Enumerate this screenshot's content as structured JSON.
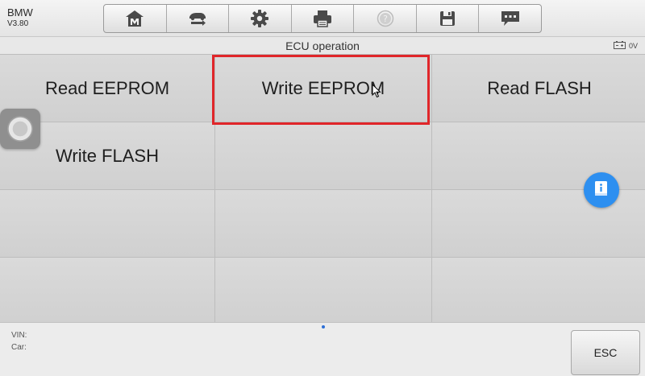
{
  "app": {
    "name": "BMW",
    "version": "V3.80"
  },
  "toolbar": {
    "buttons": [
      {
        "icon": "home-icon",
        "enabled": true
      },
      {
        "icon": "vehicle-swap-icon",
        "enabled": true
      },
      {
        "icon": "gear-icon",
        "enabled": true
      },
      {
        "icon": "printer-icon",
        "enabled": true
      },
      {
        "icon": "help-icon",
        "enabled": false
      },
      {
        "icon": "save-icon",
        "enabled": true
      },
      {
        "icon": "message-icon",
        "enabled": true
      }
    ]
  },
  "header": {
    "title": "ECU operation",
    "voltage": "0V"
  },
  "functions": [
    {
      "label": "Read EEPROM"
    },
    {
      "label": "Write EEPROM",
      "selected": true
    },
    {
      "label": "Read FLASH"
    },
    {
      "label": "Write FLASH"
    }
  ],
  "footer": {
    "vin_label": "VIN:",
    "car_label": "Car:",
    "esc_label": "ESC"
  },
  "colors": {
    "highlight": "#e0262a",
    "info_button": "#2d8ff0",
    "page_dot": "#2d6fd6"
  }
}
